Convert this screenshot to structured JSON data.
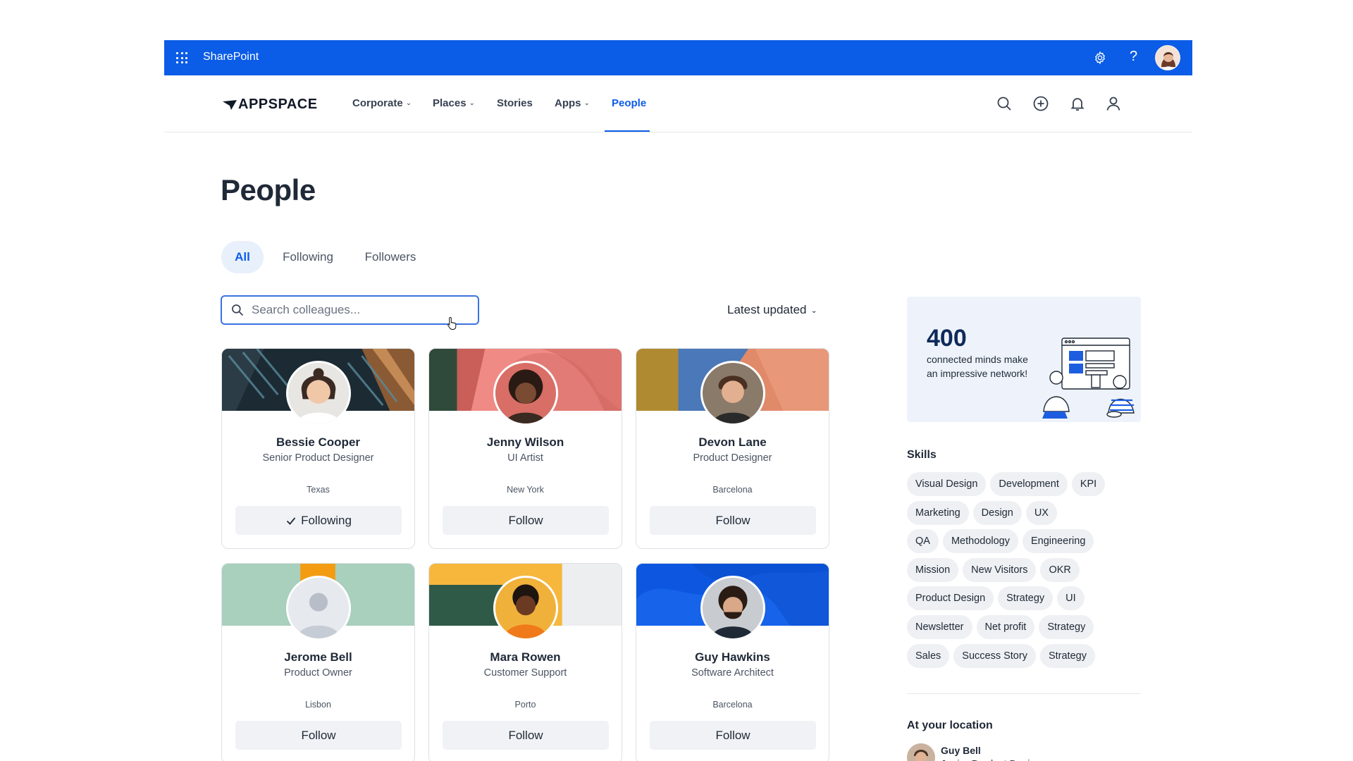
{
  "sharepoint": {
    "title": "SharePoint"
  },
  "nav": {
    "logo": "APPSPACE",
    "items": [
      {
        "label": "Corporate",
        "has_menu": true
      },
      {
        "label": "Places",
        "has_menu": true
      },
      {
        "label": "Stories",
        "has_menu": false
      },
      {
        "label": "Apps",
        "has_menu": true
      },
      {
        "label": "People",
        "has_menu": false,
        "active": true
      }
    ],
    "chevron": "⌄"
  },
  "page": {
    "title": "People",
    "tabs": [
      {
        "label": "All",
        "active": true
      },
      {
        "label": "Following"
      },
      {
        "label": "Followers"
      }
    ],
    "search_placeholder": "Search colleagues...",
    "sort_label": "Latest updated"
  },
  "people": [
    {
      "name": "Bessie Cooper",
      "role": "Senior Product Designer",
      "location": "Texas",
      "button": "Following",
      "following": true
    },
    {
      "name": "Jenny Wilson",
      "role": "UI Artist",
      "location": "New York",
      "button": "Follow",
      "following": false
    },
    {
      "name": "Devon Lane",
      "role": "Product Designer",
      "location": "Barcelona",
      "button": "Follow",
      "following": false
    },
    {
      "name": "Jerome Bell",
      "role": "Product Owner",
      "location": "Lisbon",
      "button": "Follow",
      "following": false
    },
    {
      "name": "Mara Rowen",
      "role": "Customer Support",
      "location": "Porto",
      "button": "Follow",
      "following": false
    },
    {
      "name": "Guy Hawkins",
      "role": "Software Architect",
      "location": "Barcelona",
      "button": "Follow",
      "following": false
    }
  ],
  "promo": {
    "number": "400",
    "text": "connected minds make an impressive network!"
  },
  "skills": {
    "heading": "Skills",
    "rows": [
      [
        "Visual Design",
        "Development",
        "KPI"
      ],
      [
        "Marketing",
        "Design",
        "UX"
      ],
      [
        "QA",
        "Methodology",
        "Engineering"
      ],
      [
        "Mission",
        "New Visitors",
        "OKR"
      ],
      [
        "Product Design",
        "Strategy",
        "UI"
      ],
      [
        "Newsletter",
        "Net profit",
        "Strategy"
      ],
      [
        "Sales",
        "Success Story",
        "Strategy"
      ]
    ]
  },
  "location": {
    "heading": "At your location",
    "person": {
      "name": "Guy Bell",
      "role": "Junior Product Designer"
    }
  },
  "colors": {
    "brand_blue": "#0b5ce6",
    "chip_bg": "#eef0f3",
    "button_bg": "#f0f2f5",
    "promo_bg": "#eef3fb"
  }
}
